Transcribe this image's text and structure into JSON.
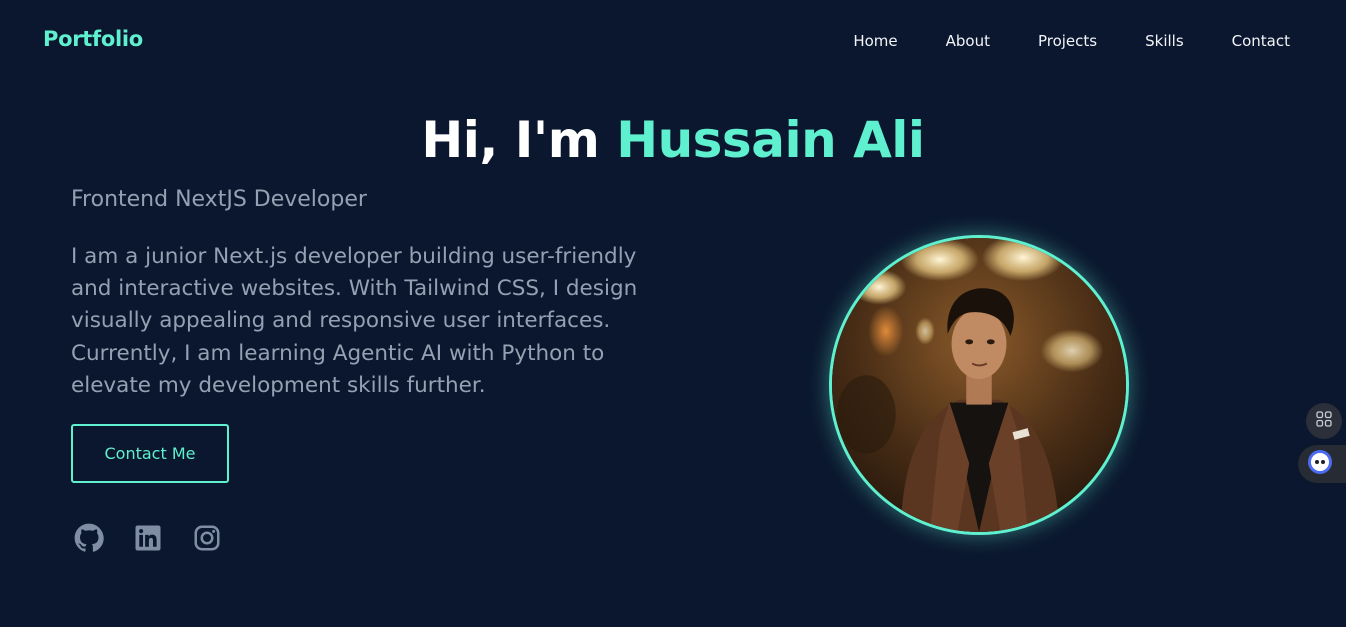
{
  "nav": {
    "brand": "Portfolio",
    "links": [
      "Home",
      "About",
      "Projects",
      "Skills",
      "Contact"
    ]
  },
  "hero": {
    "greeting": "Hi, I'm ",
    "name": "Hussain Ali",
    "role": "Frontend NextJS Developer",
    "bio": "I am a junior Next.js developer building user-friendly and interactive websites. With Tailwind CSS, I design visually appealing and responsive user interfaces. Currently, I am learning Agentic AI with Python to elevate my development skills further.",
    "cta_label": "Contact Me"
  },
  "socials": [
    {
      "icon": "github-icon"
    },
    {
      "icon": "linkedin-icon"
    },
    {
      "icon": "instagram-icon"
    }
  ],
  "widgets": {
    "grid_icon": "apps-grid-icon",
    "bot_icon": "assistant-bot-icon"
  },
  "colors": {
    "background": "#0b172e",
    "accent": "#5ff0d0",
    "muted_text": "#95a1b3"
  }
}
